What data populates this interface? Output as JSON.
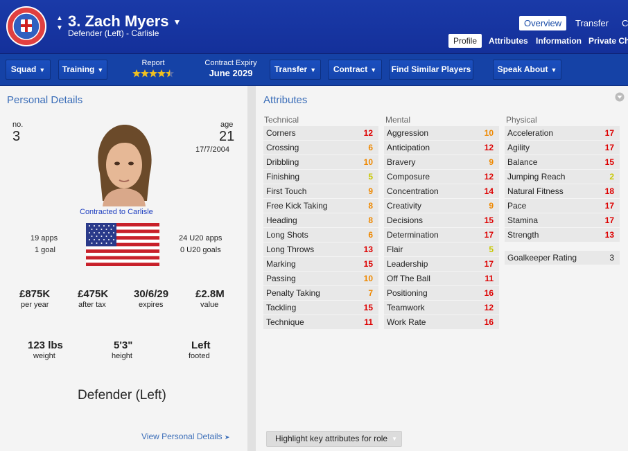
{
  "header": {
    "player_name": "3. Zach Myers",
    "subtitle": "Defender (Left) - Carlisle",
    "nav_tabs": [
      "Overview",
      "Transfer",
      "C"
    ],
    "sub_tabs": [
      "Profile",
      "Attributes",
      "Information",
      "Private Cha"
    ],
    "club_crest_label": "CARLISLE UNITED FOOTBALL CLUB"
  },
  "toolbar": {
    "squad": "Squad",
    "training": "Training",
    "report_label": "Report",
    "report_stars": 4.5,
    "contract_expiry_label": "Contract Expiry",
    "contract_expiry_value": "June 2029",
    "transfer": "Transfer",
    "contract": "Contract",
    "find_similar": "Find Similar Players",
    "speak_about": "Speak About"
  },
  "personal": {
    "title": "Personal Details",
    "no_label": "no.",
    "no_value": "3",
    "age_label": "age",
    "age_value": "21",
    "dob": "17/7/2004",
    "contracted": "Contracted to Carlisle",
    "apps": "19 apps",
    "goals": "1 goal",
    "u20_apps": "24 U20 apps",
    "u20_goals": "0 U20 goals",
    "wage": "£875K",
    "wage_label": "per year",
    "after_tax": "£475K",
    "after_tax_label": "after tax",
    "expires": "30/6/29",
    "expires_label": "expires",
    "value": "£2.8M",
    "value_label": "value",
    "weight": "123 lbs",
    "weight_label": "weight",
    "height": "5'3\"",
    "height_label": "height",
    "foot": "Left",
    "foot_label": "footed",
    "position": "Defender (Left)",
    "view_link": "View Personal Details"
  },
  "attributes": {
    "title": "Attributes",
    "technical_label": "Technical",
    "mental_label": "Mental",
    "physical_label": "Physical",
    "technical": [
      {
        "name": "Corners",
        "value": 12
      },
      {
        "name": "Crossing",
        "value": 6
      },
      {
        "name": "Dribbling",
        "value": 10
      },
      {
        "name": "Finishing",
        "value": 5
      },
      {
        "name": "First Touch",
        "value": 9
      },
      {
        "name": "Free Kick Taking",
        "value": 8
      },
      {
        "name": "Heading",
        "value": 8
      },
      {
        "name": "Long Shots",
        "value": 6
      },
      {
        "name": "Long Throws",
        "value": 13
      },
      {
        "name": "Marking",
        "value": 15
      },
      {
        "name": "Passing",
        "value": 10
      },
      {
        "name": "Penalty Taking",
        "value": 7
      },
      {
        "name": "Tackling",
        "value": 15
      },
      {
        "name": "Technique",
        "value": 11
      }
    ],
    "mental": [
      {
        "name": "Aggression",
        "value": 10
      },
      {
        "name": "Anticipation",
        "value": 12
      },
      {
        "name": "Bravery",
        "value": 9
      },
      {
        "name": "Composure",
        "value": 12
      },
      {
        "name": "Concentration",
        "value": 14
      },
      {
        "name": "Creativity",
        "value": 9
      },
      {
        "name": "Decisions",
        "value": 15
      },
      {
        "name": "Determination",
        "value": 17
      },
      {
        "name": "Flair",
        "value": 5
      },
      {
        "name": "Leadership",
        "value": 17
      },
      {
        "name": "Off The Ball",
        "value": 11
      },
      {
        "name": "Positioning",
        "value": 16
      },
      {
        "name": "Teamwork",
        "value": 12
      },
      {
        "name": "Work Rate",
        "value": 16
      }
    ],
    "physical": [
      {
        "name": "Acceleration",
        "value": 17
      },
      {
        "name": "Agility",
        "value": 17
      },
      {
        "name": "Balance",
        "value": 15
      },
      {
        "name": "Jumping Reach",
        "value": 2
      },
      {
        "name": "Natural Fitness",
        "value": 18
      },
      {
        "name": "Pace",
        "value": 17
      },
      {
        "name": "Stamina",
        "value": 17
      },
      {
        "name": "Strength",
        "value": 13
      }
    ],
    "gk_rating_label": "Goalkeeper Rating",
    "gk_rating_value": "3",
    "highlight_button": "Highlight key attributes for role"
  },
  "colors": {
    "header_blue": "#1a3aa8",
    "toolbar_blue": "#1542a6",
    "panel_bg": "#f4f4f4",
    "title_blue": "#3a6db8",
    "attr_red": "#dd0000",
    "attr_orange": "#ee8800",
    "attr_yellow": "#c8c800"
  }
}
